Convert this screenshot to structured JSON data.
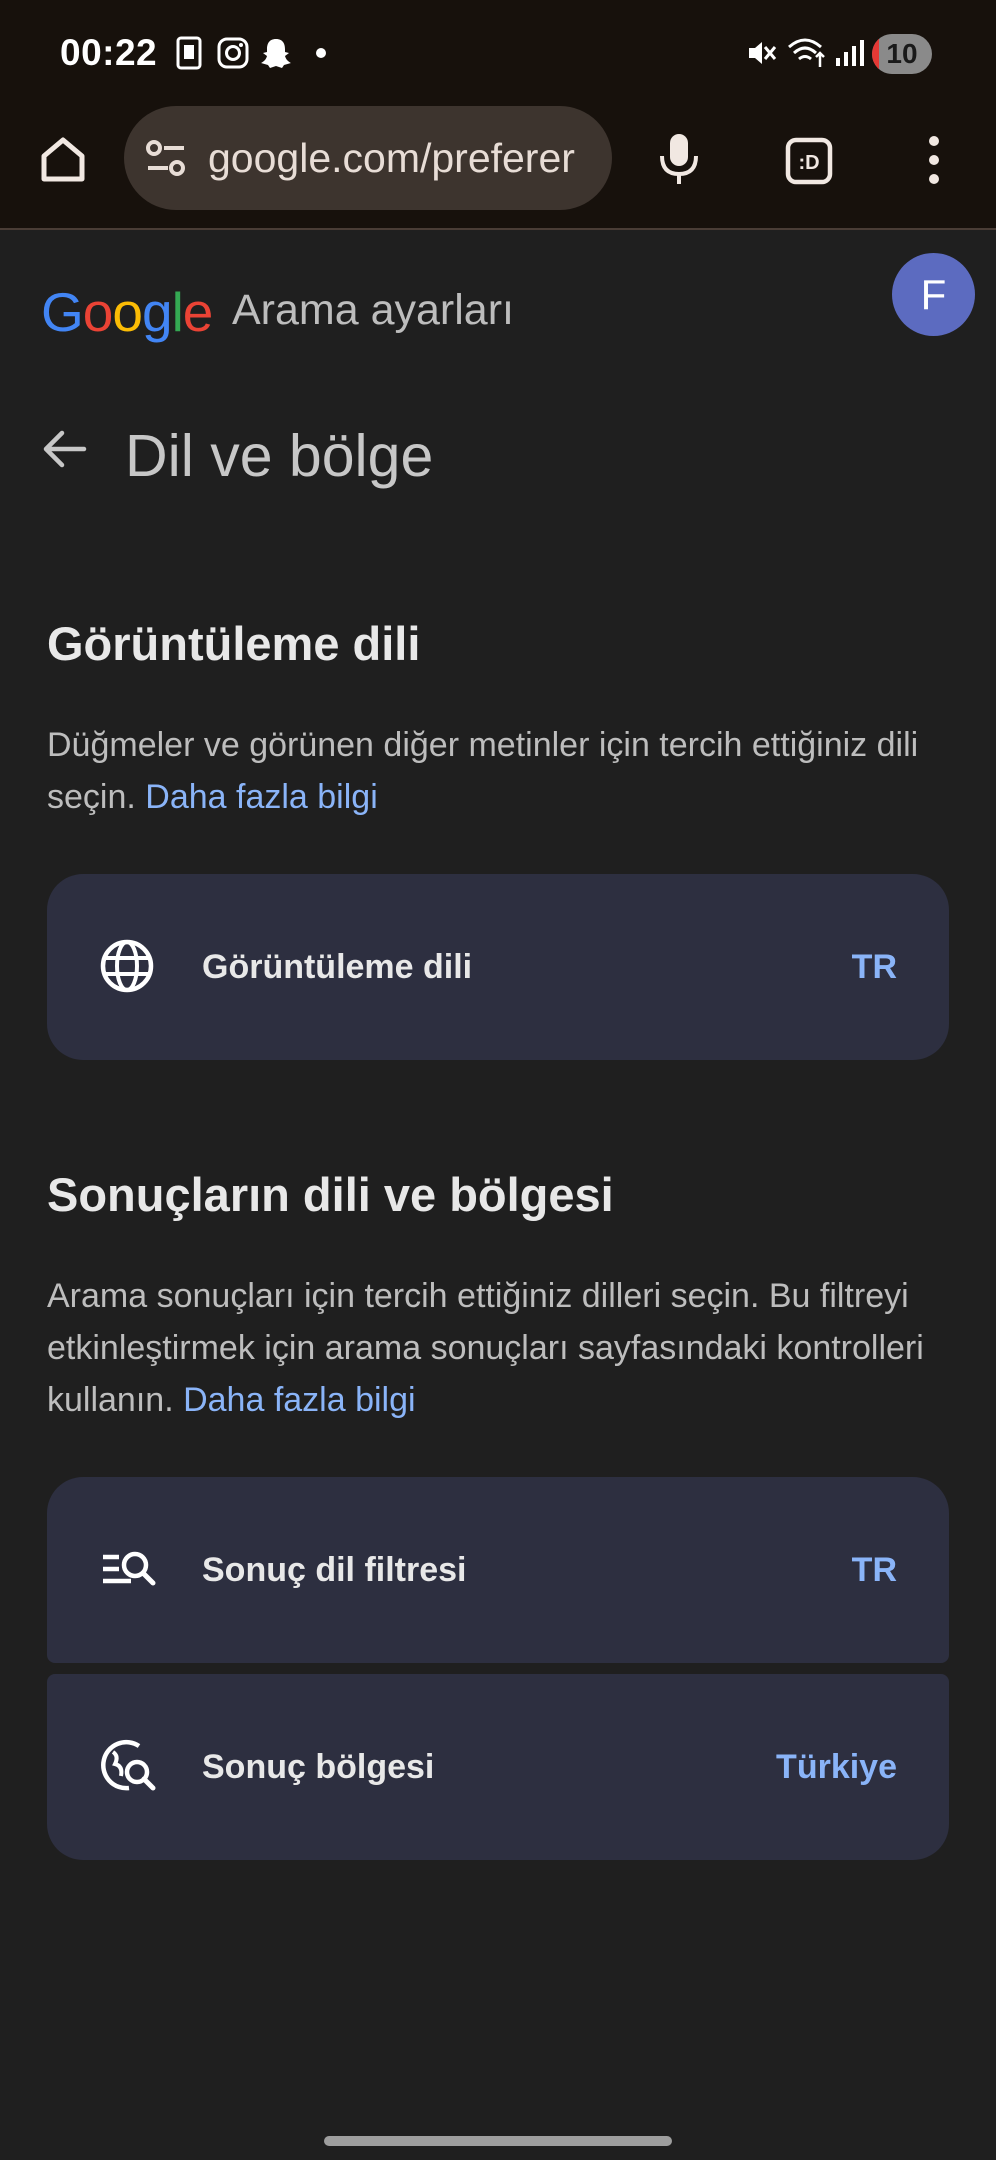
{
  "status_bar": {
    "time": "00:22",
    "battery": "10",
    "battery_level": 0.1,
    "left_icons": [
      "notification-icon",
      "instagram-icon",
      "snapchat-icon",
      "dot-icon"
    ],
    "right_icons": [
      "mute-icon",
      "wifi-icon",
      "signal-icon"
    ]
  },
  "browser": {
    "url": "google.com/preferer",
    "icons": [
      "home-icon",
      "site-settings-icon",
      "mic-icon",
      "tab-switcher-icon",
      "more-icon"
    ]
  },
  "header": {
    "logo_letters": [
      {
        "char": "G",
        "color": "#4285f4"
      },
      {
        "char": "o",
        "color": "#ea4335"
      },
      {
        "char": "o",
        "color": "#fbbc05"
      },
      {
        "char": "g",
        "color": "#4285f4"
      },
      {
        "char": "l",
        "color": "#34a853"
      },
      {
        "char": "e",
        "color": "#ea4335"
      }
    ],
    "title": "Arama ayarları",
    "avatar_initial": "F"
  },
  "page": {
    "title": "Dil ve bölge"
  },
  "display_language": {
    "heading": "Görüntüleme dili",
    "description": "Düğmeler ve görünen diğer metinler için tercih ettiğiniz dili seçin.",
    "link": "Daha fazla bilgi",
    "card": {
      "label": "Görüntüleme dili",
      "value": "TR",
      "icon": "globe-icon"
    }
  },
  "results_language": {
    "heading": "Sonuçların dili ve bölgesi",
    "description": "Arama sonuçları için tercih ettiğiniz dilleri seçin. Bu filtreyi etkinleştirmek için arama sonuçları sayfasındaki kontrolleri kullanın.",
    "link": "Daha fazla bilgi",
    "cards": [
      {
        "label": "Sonuç dil filtresi",
        "value": "TR",
        "icon": "filter-search-icon"
      },
      {
        "label": "Sonuç bölgesi",
        "value": "Türkiye",
        "icon": "region-search-icon"
      }
    ]
  },
  "colors": {
    "background": "#1f1f1f",
    "card": "#2d2f40",
    "link": "#8ab4f8",
    "avatar": "#5c6bc0"
  }
}
